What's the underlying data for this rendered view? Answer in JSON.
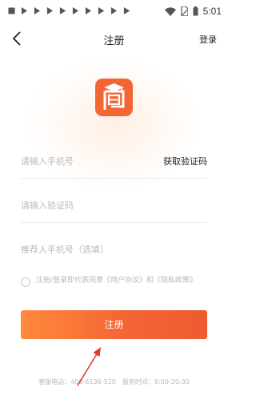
{
  "status_bar": {
    "time": "5:01",
    "icons": [
      "notification-icon",
      "play-icon",
      "play-icon",
      "play-icon",
      "play-icon",
      "play-icon",
      "play-icon",
      "play-icon",
      "play-icon",
      "play-icon",
      "wifi-icon",
      "battery-icon"
    ]
  },
  "header": {
    "title": "注册",
    "login_label": "登录"
  },
  "form": {
    "phone_placeholder": "请输入手机号",
    "get_code_label": "获取验证码",
    "code_placeholder": "请输入验证码",
    "referrer_placeholder": "推荐人手机号（选填）"
  },
  "agreement": {
    "text": "注册/登录即代表同意《用户协议》和《隐私政策》"
  },
  "register_button": {
    "label": "注册"
  },
  "footer": {
    "text": "客服电话：400-6136-520　服务时间：9:00-20:30"
  },
  "colors": {
    "accent": "#f46534",
    "annotation_arrow": "#e23b2e"
  }
}
